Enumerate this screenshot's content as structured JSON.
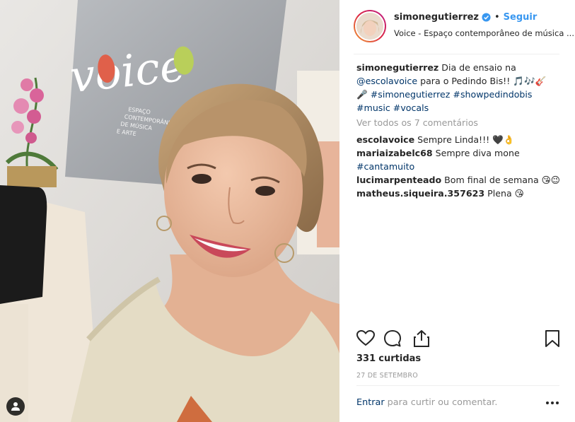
{
  "photo": {
    "sign_text": "voice",
    "sign_subtext": [
      "ESPAÇO",
      "CONTEMPORÂNEO",
      "DE MÚSICA",
      "E ARTE"
    ]
  },
  "header": {
    "username": "simonegutierrez",
    "separator": "•",
    "follow_label": "Seguir",
    "location": "Voice - Espaço contemporâneo de música ..."
  },
  "caption": {
    "username": "simonegutierrez",
    "text_1": "Dia de ensaio na",
    "mention": "@escolavoice",
    "text_2": "para o Pedindo Bis!!",
    "emojis_1": "🎵🎶🎸",
    "emoji_mic": "🎤",
    "hashtags_1": "#simonegutierrez #showpedindobis",
    "hashtags_2": "#music #vocals"
  },
  "view_all": "Ver todos os 7 comentários",
  "comments": [
    {
      "username": "escolavoice",
      "text": "Sempre Linda!!! 🖤👌",
      "hashtag": ""
    },
    {
      "username": "mariaizabelc68",
      "text": "Sempre diva mone",
      "hashtag": "#cantamuito"
    },
    {
      "username": "lucimarpenteado",
      "text": "Bom final de semana 😘😉",
      "hashtag": ""
    },
    {
      "username": "matheus.siqueira.357623",
      "text": "Plena 😘",
      "hashtag": ""
    }
  ],
  "icons": {
    "like": "heart-icon",
    "comment": "comment-bubble-icon",
    "share": "share-icon",
    "save": "bookmark-icon",
    "verified": "verified-badge-icon",
    "more": "more-options-icon",
    "tag": "user-tag-icon"
  },
  "likes": {
    "count": "331",
    "label": "curtidas"
  },
  "date": "27 DE SETEMBRO",
  "comment_box": {
    "enter_label": "Entrar",
    "prompt": "para curtir ou comentar."
  },
  "colors": {
    "accent": "#3897f0",
    "link": "#003569",
    "muted": "#999999",
    "verified": "#3897f0"
  }
}
